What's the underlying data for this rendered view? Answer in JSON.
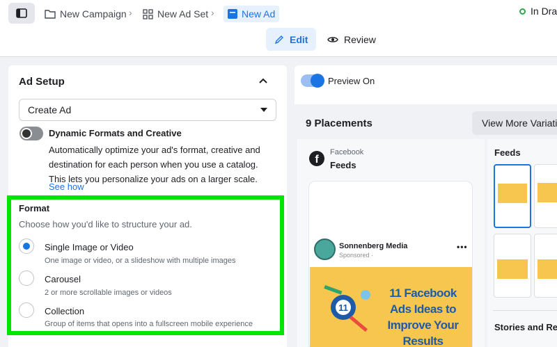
{
  "breadcrumb": {
    "items": [
      {
        "label": "New Campaign"
      },
      {
        "label": "New Ad Set"
      },
      {
        "label": "New Ad"
      }
    ]
  },
  "status": {
    "label": "In Draft"
  },
  "tabs": {
    "edit": "Edit",
    "review": "Review"
  },
  "ad_setup": {
    "title": "Ad Setup",
    "select_value": "Create Ad",
    "dynamic": {
      "title": "Dynamic Formats and Creative",
      "description": "Automatically optimize your ad's format, creative and destination for each person when you use a catalog. This lets you personalize your ads on a larger scale.",
      "link": "See how",
      "enabled": false
    }
  },
  "format": {
    "title": "Format",
    "subtitle": "Choose how you'd like to structure your ad.",
    "options": [
      {
        "label": "Single Image or Video",
        "desc": "One image or video, or a slideshow with multiple images",
        "selected": true
      },
      {
        "label": "Carousel",
        "desc": "2 or more scrollable images or videos",
        "selected": false
      },
      {
        "label": "Collection",
        "desc": "Group of items that opens into a fullscreen mobile experience",
        "selected": false
      }
    ]
  },
  "preview": {
    "toggle_label": "Preview On",
    "placements_title": "9 Placements",
    "view_more": "View More Variations",
    "source": "Facebook",
    "placement": "Feeds",
    "post": {
      "page_name": "Sonnenberg Media",
      "sponsored": "Sponsored · ",
      "headline": "11 Facebook Ads Ideas to Improve Your Results"
    },
    "side_feeds_label": "Feeds",
    "side_stories_label": "Stories and Reels"
  },
  "colors": {
    "accent": "#1b74e4",
    "highlight": "#00e600",
    "creative_bg": "#f7c64f"
  }
}
